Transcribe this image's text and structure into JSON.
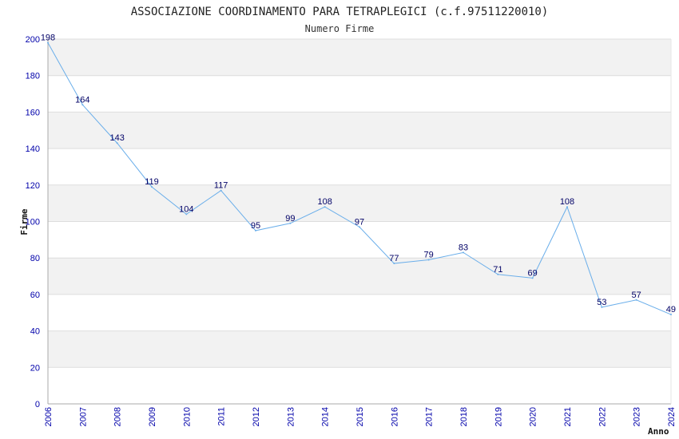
{
  "chart_data": {
    "type": "line",
    "title": "ASSOCIAZIONE COORDINAMENTO PARA TETRAPLEGICI (c.f.97511220010)",
    "subtitle": "Numero Firme",
    "xlabel": "Anno",
    "ylabel": "Firme",
    "ylim": [
      0,
      200
    ],
    "yticks": [
      0,
      20,
      40,
      60,
      80,
      100,
      120,
      140,
      160,
      180,
      200
    ],
    "x": [
      "2006",
      "2007",
      "2008",
      "2009",
      "2010",
      "2011",
      "2012",
      "2013",
      "2014",
      "2015",
      "2016",
      "2017",
      "2018",
      "2019",
      "2020",
      "2021",
      "2022",
      "2023",
      "2024"
    ],
    "values": [
      198,
      164,
      143,
      119,
      104,
      117,
      95,
      99,
      108,
      97,
      77,
      79,
      83,
      71,
      69,
      108,
      53,
      57,
      49
    ],
    "grid": true,
    "legend": "none",
    "colors": {
      "line": "#6aaeea",
      "tick_text": "#0000aa",
      "data_label": "#000066",
      "band_shaded": "#f2f2f2",
      "band_plain": "#ffffff",
      "gridline": "#dddddd",
      "axis": "#aaaaaa"
    }
  }
}
